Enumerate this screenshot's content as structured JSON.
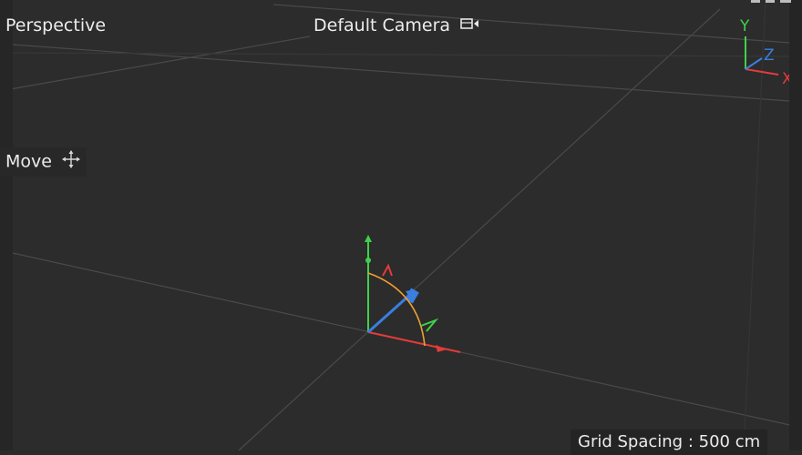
{
  "viewport": {
    "view_name": "Perspective",
    "camera_name": "Default Camera",
    "tool_label": "Move",
    "grid_spacing": "Grid Spacing : 500 cm"
  },
  "axis_gizmo": {
    "y_label": "Y",
    "z_label": "Z",
    "x_label": "X"
  },
  "icons": {
    "camera": "camera-icon",
    "move": "move-icon"
  },
  "colors": {
    "background": "#2c2c2c",
    "axis_x": "#e53b3b",
    "axis_y": "#3fd14a",
    "axis_z": "#3a7ee0",
    "rotation_arc": "#f0a030",
    "grid": "#4a4a4a"
  }
}
